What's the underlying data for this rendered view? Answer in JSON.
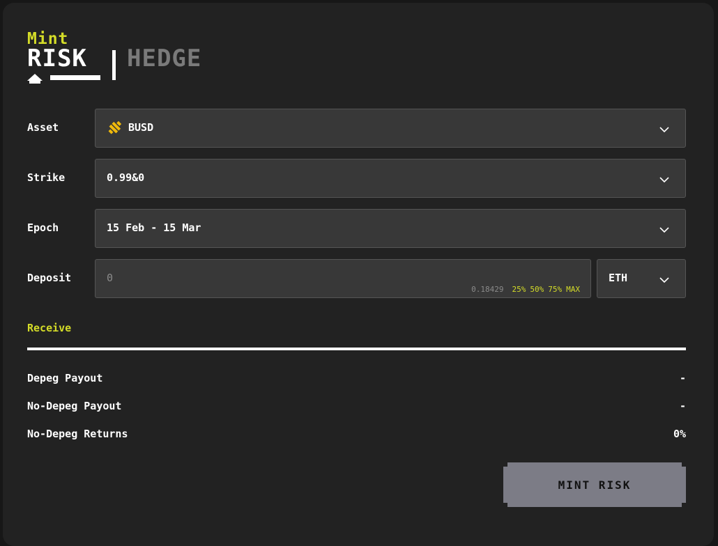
{
  "header": {
    "eyebrow": "Mint",
    "tabs": [
      {
        "label": "RISK",
        "active": true
      },
      {
        "label": "HEDGE",
        "active": false
      }
    ]
  },
  "form": {
    "asset": {
      "label": "Asset",
      "value": "BUSD",
      "icon": "busd-icon"
    },
    "strike": {
      "label": "Strike",
      "value": "0.99&0"
    },
    "epoch": {
      "label": "Epoch",
      "value": "15 Feb - 15 Mar"
    },
    "deposit": {
      "label": "Deposit",
      "placeholder": "0",
      "balance": "0.18429",
      "quick_amounts": [
        "25%",
        "50%",
        "75%",
        "MAX"
      ],
      "token": "ETH"
    }
  },
  "receive": {
    "title": "Receive",
    "rows": [
      {
        "label": "Depeg Payout",
        "value": "-"
      },
      {
        "label": "No-Depeg Payout",
        "value": "-"
      },
      {
        "label": "No-Depeg Returns",
        "value": "0%"
      }
    ]
  },
  "actions": {
    "submit_label": "MINT RISK"
  },
  "colors": {
    "accent": "#d4dc28",
    "background": "#222222",
    "field": "#383838",
    "button": "#7c7c86",
    "busd": "#f0b90b"
  }
}
